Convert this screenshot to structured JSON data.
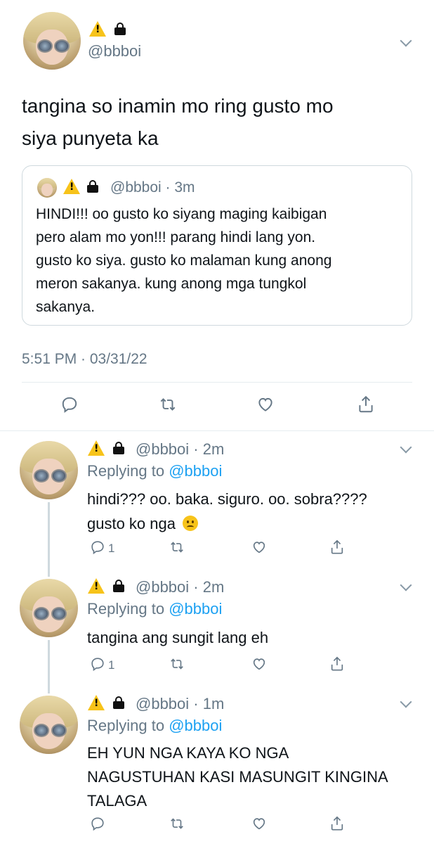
{
  "main_tweet": {
    "handle": "@bbboi",
    "text_line1": "tangina so inamin mo ring gusto mo",
    "text_line2": "siya punyeta ka",
    "timestamp": "5:51 PM · 03/31/22"
  },
  "quoted_tweet": {
    "handle_time": "@bbboi · 3m",
    "lines": [
      "HINDI!!! oo gusto ko siyang maging kaibigan",
      "pero alam mo yon!!! parang hindi lang yon.",
      "gusto ko siya. gusto ko malaman kung anong",
      "meron sakanya. kung anong mga tungkol",
      "sakanya."
    ]
  },
  "replies": [
    {
      "handle_time": "@bbboi · 2m",
      "replying_prefix": "Replying to",
      "replying_handle": "@bbboi",
      "lines": [
        "hindi??? oo. baka. siguro. oo. sobra????",
        "gusto ko nga"
      ],
      "reply_count": "1"
    },
    {
      "handle_time": "@bbboi · 2m",
      "replying_prefix": "Replying to",
      "replying_handle": "@bbboi",
      "lines": [
        "tangina ang sungit lang eh"
      ],
      "reply_count": "1"
    },
    {
      "handle_time": "@bbboi · 1m",
      "replying_prefix": "Replying to",
      "replying_handle": "@bbboi",
      "lines": [
        "EH YUN NGA KAYA KO NGA",
        "NAGUSTUHAN KASI MASUNGIT KINGINA",
        "TALAGA"
      ],
      "reply_count": ""
    }
  ],
  "icons": {
    "reply": "reply-icon",
    "retweet": "retweet-icon",
    "like": "heart-icon",
    "share": "share-icon",
    "more": "chevron-down-icon",
    "warning": "warning-emoji",
    "lock": "lock-emoji",
    "frown": "frowning-face-emoji"
  },
  "colors": {
    "link": "#1da1f2",
    "muted": "#657786",
    "divider": "#e6ecf0"
  }
}
